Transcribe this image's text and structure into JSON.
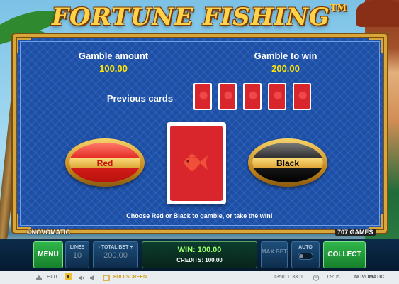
{
  "logo": {
    "title": "FORTUNE FISHING",
    "tm": "TM"
  },
  "gamble": {
    "amount_label": "Gamble amount",
    "amount_value": "100.00",
    "to_win_label": "Gamble to win",
    "to_win_value": "200.00",
    "previous_label": "Previous cards",
    "previous_cards": [
      "red",
      "red",
      "red",
      "red",
      "red"
    ],
    "red_label": "Red",
    "black_label": "Black",
    "hint": "Choose Red or Black to gamble, or take the win!"
  },
  "brand": {
    "novomatic_small": "©NOVOMATIC",
    "games707": "707 GAMES"
  },
  "controls": {
    "menu": "MENU",
    "lines_label": "LINES",
    "lines_value": "10",
    "total_bet_label": "- TOTAL BET +",
    "total_bet_value": "200.00",
    "win_text": "WIN: 100.00",
    "credits_text": "CREDITS: 100.00",
    "max_bet_label": "MAX BET",
    "auto_label": "AUTO",
    "collect": "COLLECT"
  },
  "status": {
    "exit": "EXIT",
    "fullscreen": "FULLSCREEN",
    "session_id": "13501113301",
    "time": "09:05",
    "brand": "NOVOMATIC"
  },
  "colors": {
    "panel": "#1c4fa8",
    "frame": "#d9a63a",
    "accent_green": "#2fb54a",
    "value_yellow": "#ffe600"
  }
}
